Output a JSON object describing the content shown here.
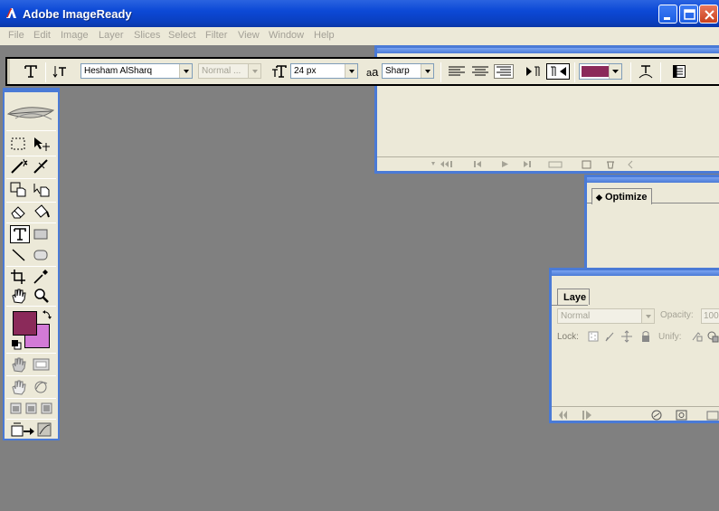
{
  "window": {
    "title": "Adobe ImageReady",
    "controls": {
      "minimize": "minimize",
      "maximize": "maximize",
      "close": "close"
    }
  },
  "menu": [
    "File",
    "Edit",
    "Image",
    "Layer",
    "Slices",
    "Select",
    "Filter",
    "View",
    "Window",
    "Help"
  ],
  "options_bar": {
    "tool_icon": "type-tool-icon",
    "font_family": "Hesham AlSharq",
    "font_style": "Normal ...",
    "font_size": "24 px",
    "antialias_label": "a",
    "antialias_sub": "a",
    "antialias": "Sharp",
    "text_color": "#8b2a5a"
  },
  "toolbox": {
    "foreground_color": "#8b2a5a",
    "background_color": "#d27ad6"
  },
  "palettes": {
    "optimize_tab": "Optimize",
    "layers_tab": "Laye",
    "layers_blend": "Normal",
    "layers_opacity_label": "Opacity:",
    "layers_opacity_value": "100",
    "layers_lock_label": "Lock:",
    "layers_unify_label": "Unify:"
  }
}
